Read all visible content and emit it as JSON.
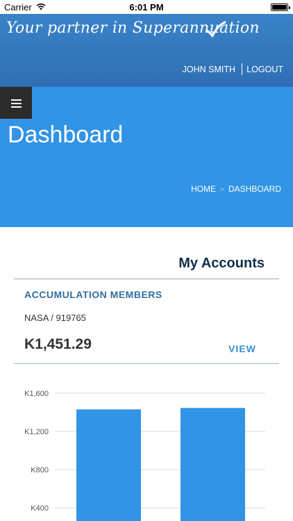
{
  "status_bar": {
    "carrier": "Carrier",
    "time": "6:01 PM",
    "wifi_icon": "wifi-icon",
    "battery_icon": "battery-icon"
  },
  "header": {
    "tagline": "Your partner in Superannuation",
    "tagline_icon": "checkmark-icon",
    "user_name": "JOHN SMITH",
    "logout_label": "LOGOUT",
    "background_color": "#3178bf"
  },
  "banner": {
    "menu_icon": "hamburger-menu-icon",
    "title": "Dashboard",
    "breadcrumb": {
      "home": "HOME",
      "separator": ">",
      "current": "DASHBOARD"
    },
    "background_color": "#3194e6"
  },
  "accounts": {
    "section_title": "My Accounts",
    "member_type": "ACCUMULATION MEMBERS",
    "account_id": "NASA / 919765",
    "balance": "K1,451.29",
    "view_label": "VIEW"
  },
  "chart_data": {
    "type": "bar",
    "categories": [
      "",
      ""
    ],
    "values": [
      1430,
      1445
    ],
    "y_ticks": [
      "K1,600",
      "K1,200",
      "K800",
      "K400"
    ],
    "ylim": [
      0,
      1600
    ],
    "grid": true,
    "bar_color": "#3194e6",
    "title": "",
    "xlabel": "",
    "ylabel": ""
  }
}
